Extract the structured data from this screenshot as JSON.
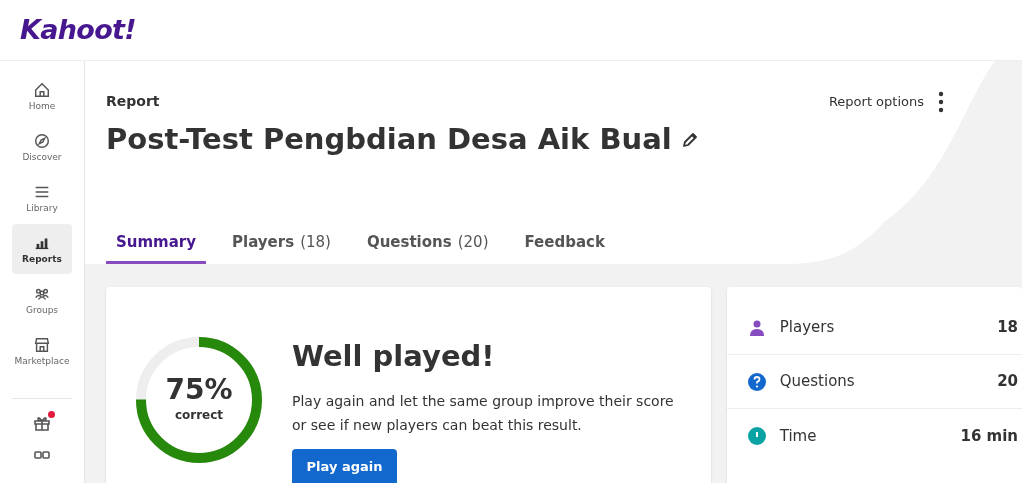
{
  "logo": "Kahoot!",
  "sidebar": {
    "items": [
      {
        "label": "Home",
        "selected": false
      },
      {
        "label": "Discover",
        "selected": false
      },
      {
        "label": "Library",
        "selected": false
      },
      {
        "label": "Reports",
        "selected": true
      },
      {
        "label": "Groups",
        "selected": false
      },
      {
        "label": "Marketplace",
        "selected": false
      }
    ],
    "bottom": [
      {
        "notification": true
      },
      {
        "notification": false
      }
    ]
  },
  "header": {
    "eyebrow": "Report",
    "title": "Post-Test Pengbdian Desa Aik Bual",
    "options": "Report options"
  },
  "tabs": [
    {
      "label": "Summary",
      "selected": true
    },
    {
      "label": "Players",
      "count": "(18)",
      "selected": false
    },
    {
      "label": "Questions",
      "count": "(20)",
      "selected": false
    },
    {
      "label": "Feedback",
      "selected": false
    }
  ],
  "summary": {
    "percent": "75%",
    "caption": "correct",
    "level": 0.75,
    "heading": "Well played!",
    "text": "Play again and let the same group improve their score or see if new players can beat this result.",
    "button": "Play again"
  },
  "stats": [
    {
      "label": "Players",
      "value": "18"
    },
    {
      "label": "Questions",
      "value": "20"
    },
    {
      "label": "Time",
      "value": "16 min"
    }
  ]
}
